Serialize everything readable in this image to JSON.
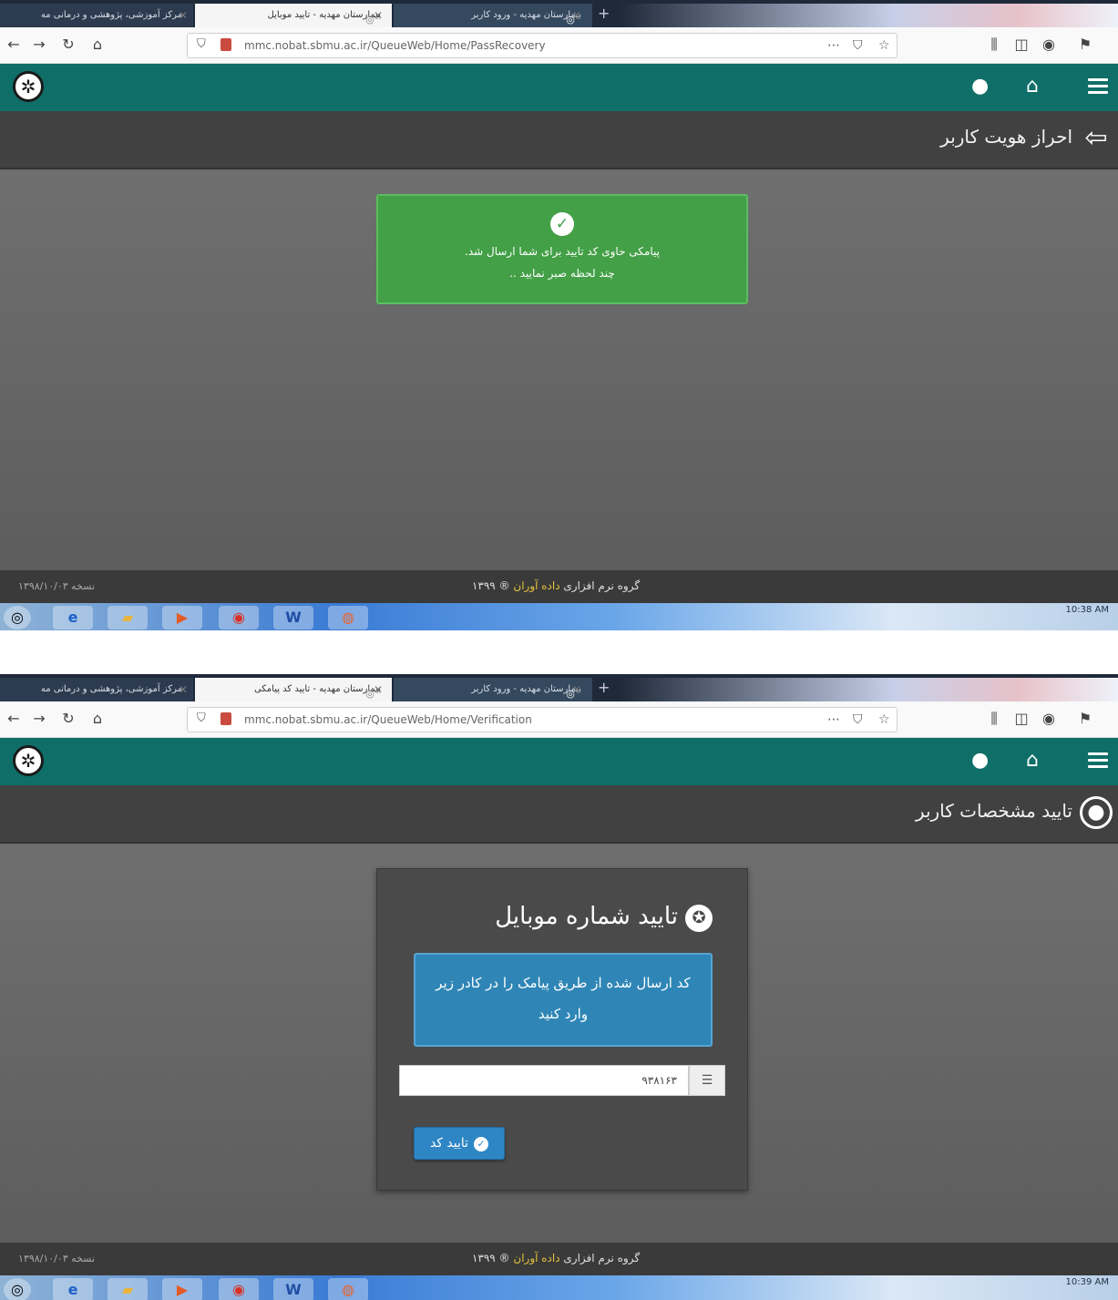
{
  "screens": [
    {
      "tabs": [
        "مرکز آموزشی، پژوهشی و درمانی مه",
        "بیمارستان مهدیه - تایید موبایل",
        "بیمارستان مهدیه - ورود کاربر"
      ],
      "url": "mmc.nobat.sbmu.ac.ir/QueueWeb/Home/PassRecovery",
      "page_title": "احراز هویت کاربر",
      "alert": {
        "line1": "پیامکی حاوی کد تایید برای شما ارسال شد.",
        "line2": "چند لحظه صبر نمایید .."
      },
      "footer": {
        "prefix": "گروه نرم افزاری",
        "brand": "داده آوران",
        "suffix": "® ۱۳۹۹",
        "version": "نسخه ۱۳۹۸/۱۰/۰۳"
      },
      "clock": "10:38 AM"
    },
    {
      "tabs": [
        "مرکز آموزشی، پژوهشی و درمانی مه",
        "بیمارستان مهدیه - تایید کد پیامکی",
        "بیمارستان مهدیه - ورود کاربر"
      ],
      "url": "mmc.nobat.sbmu.ac.ir/QueueWeb/Home/Verification",
      "page_title": "تایید مشخصات کاربر",
      "card": {
        "title": "تایید شماره موبایل",
        "info": "کد ارسال شده از طریق پیامک را در کادر زیر وارد کنید",
        "code_value": "۹۳۸۱۶۳",
        "button": "تایید کد"
      },
      "footer": {
        "prefix": "گروه نرم افزاری",
        "brand": "داده آوران",
        "suffix": "® ۱۳۹۹",
        "version": "نسخه ۱۳۹۸/۱۰/۰۳"
      },
      "clock": "10:39 AM"
    }
  ],
  "icons": {
    "back": "arrow-left-icon",
    "forward": "arrow-right-icon",
    "reload": "reload-icon",
    "home": "home-icon",
    "user": "user-icon",
    "menu": "hamburger-menu-icon",
    "signin": "sign-in-icon",
    "user_circle": "user-circle-icon",
    "check": "check-circle-icon",
    "accessibility": "accessibility-icon",
    "list": "list-icon"
  },
  "colors": {
    "header": "#0f6e68",
    "success": "#43a047",
    "info": "#2f86b6",
    "button": "#2f86c5"
  }
}
